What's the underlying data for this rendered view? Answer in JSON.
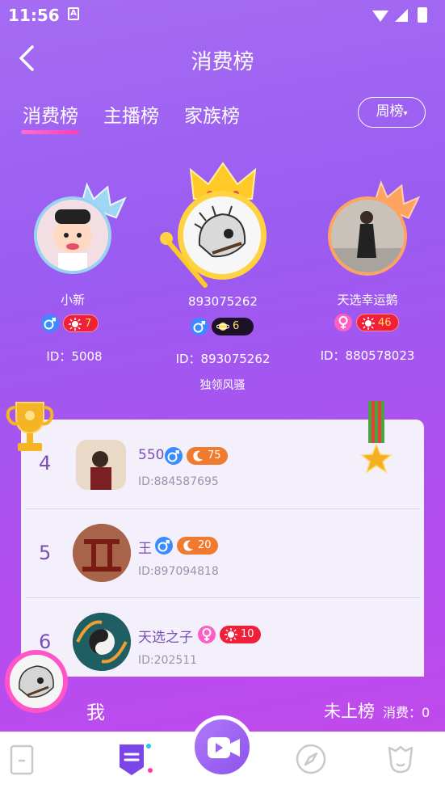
{
  "status_bar": {
    "time": "11:56",
    "notification_icon": "A"
  },
  "header": {
    "title": "消费榜"
  },
  "tabs": {
    "items": [
      {
        "label": "消费榜"
      },
      {
        "label": "主播榜"
      },
      {
        "label": "家族榜"
      }
    ],
    "active": 0,
    "period_label": "周榜"
  },
  "podium": [
    {
      "rank": 2,
      "name": "小新",
      "gender": "male",
      "level": "7",
      "id_text": "ID：5008"
    },
    {
      "rank": 1,
      "name": "893075262",
      "gender": "male",
      "level": "6",
      "id_text": "ID：893075262",
      "slogan": "独领风骚"
    },
    {
      "rank": 3,
      "name": "天选幸运鹅",
      "gender": "female",
      "level": "46",
      "id_text": "ID：880578023"
    }
  ],
  "ranking_list": [
    {
      "rank": "4",
      "name": "550",
      "gender": "male",
      "level": "75",
      "id_text": "ID:884587695"
    },
    {
      "rank": "5",
      "name": "王",
      "gender": "male",
      "level": "20",
      "id_text": "ID:897094818"
    },
    {
      "rank": "6",
      "name": "天选之子",
      "gender": "female",
      "level": "10",
      "id_text": "ID:202511"
    }
  ],
  "self": {
    "label": "我",
    "status": "未上榜",
    "consume": "消费：0"
  },
  "bottom_nav": {
    "items": [
      "phone-icon",
      "ranking-icon",
      "video-icon",
      "compass-icon",
      "profile-icon"
    ]
  },
  "colors": {
    "accent_purple": "#9a5cf1",
    "pink": "#ff55c8",
    "male_blue": "#3a8bff",
    "female_pink": "#ff5fc2"
  }
}
